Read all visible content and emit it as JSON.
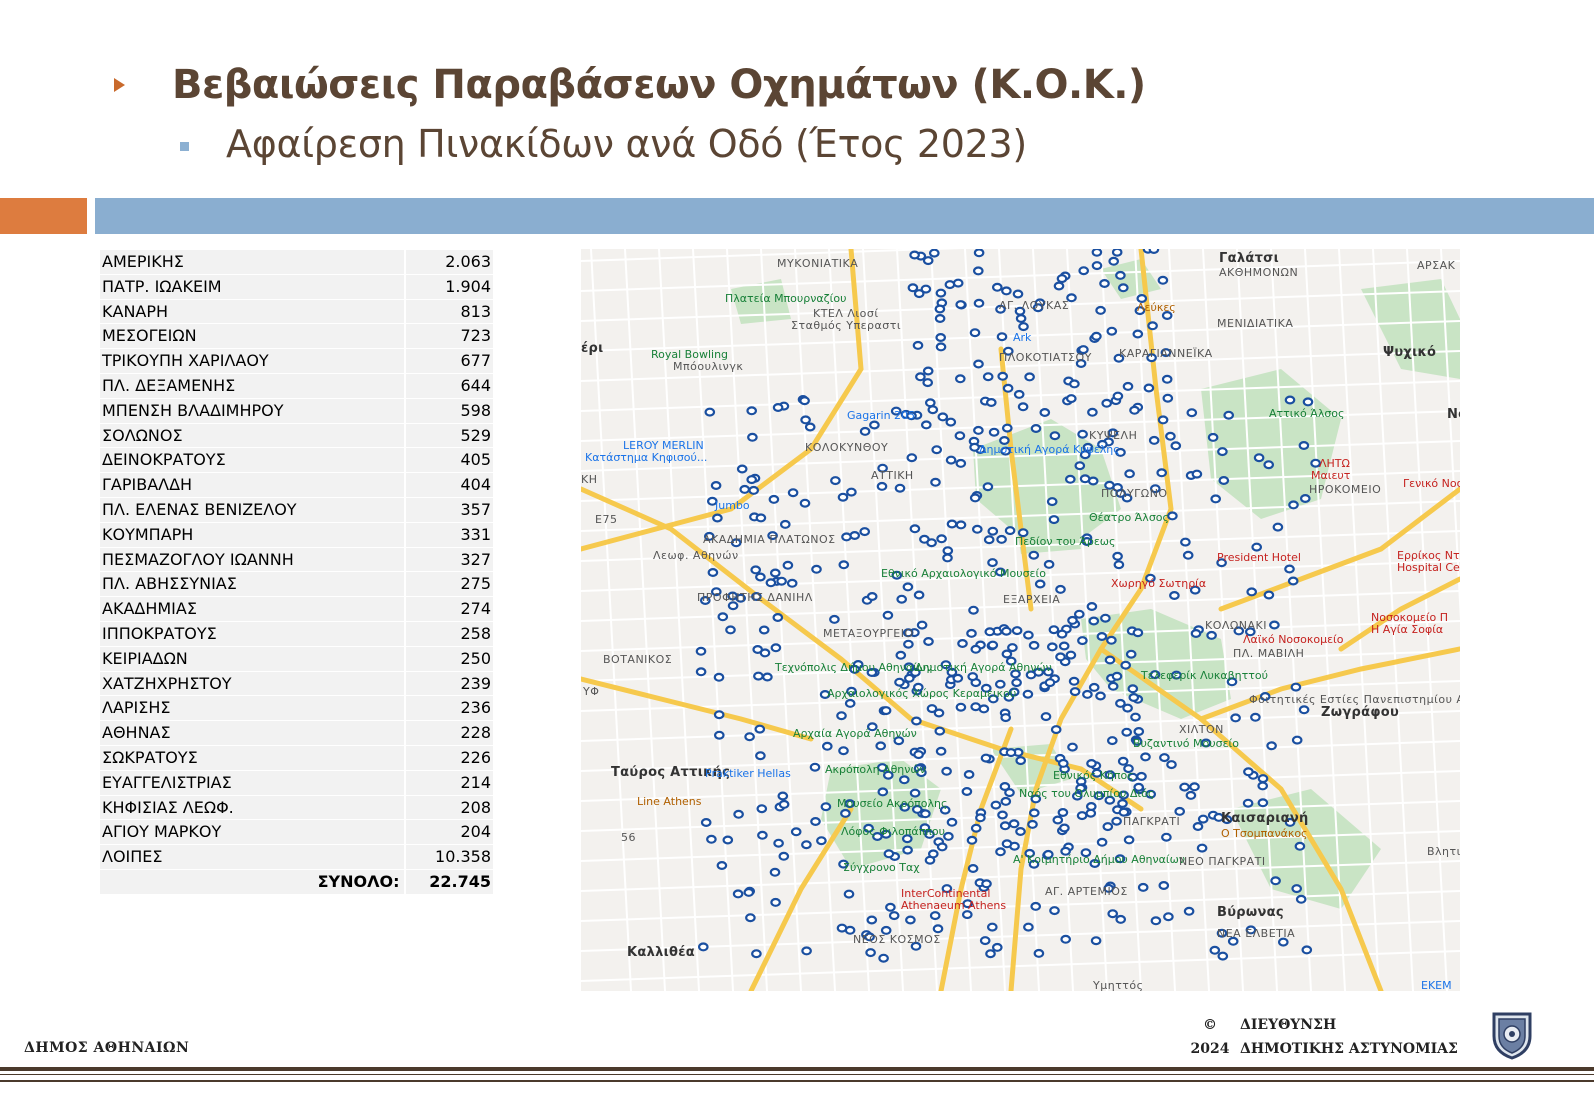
{
  "header": {
    "title": "Βεβαιώσεις Παραβάσεων Οχημάτων (Κ.Ο.Κ.)",
    "subtitle": "Αφαίρεση Πινακίδων ανά Οδό (Έτος 2023)",
    "accent_color": "#dd7c3f",
    "band_color": "#8aaed0",
    "text_color": "#5b4534"
  },
  "table": {
    "rows": [
      {
        "street": "ΑΜΕΡΙΚΗΣ",
        "count": "2.063"
      },
      {
        "street": "ΠΑΤΡ. ΙΩΑΚΕΙΜ",
        "count": "1.904"
      },
      {
        "street": "ΚΑΝΑΡΗ",
        "count": "813"
      },
      {
        "street": "ΜΕΣΟΓΕΙΩΝ",
        "count": "723"
      },
      {
        "street": "ΤΡΙΚΟΥΠΗ ΧΑΡΙΛΑΟΥ",
        "count": "677"
      },
      {
        "street": "ΠΛ. ΔΕΞΑΜΕΝΗΣ",
        "count": "644"
      },
      {
        "street": "ΜΠΕΝΣΗ ΒΛΑΔΙΜΗΡΟΥ",
        "count": "598"
      },
      {
        "street": "ΣΟΛΩΝΟΣ",
        "count": "529"
      },
      {
        "street": "ΔΕΙΝΟΚΡΑΤΟΥΣ",
        "count": "405"
      },
      {
        "street": "ΓΑΡΙΒΑΛΔΗ",
        "count": "404"
      },
      {
        "street": "ΠΛ. ΕΛΕΝΑΣ ΒΕΝΙΖΕΛΟΥ",
        "count": "357"
      },
      {
        "street": "ΚΟΥΜΠΑΡΗ",
        "count": "331"
      },
      {
        "street": "ΠΕΣΜΑΖΟΓΛΟΥ ΙΩΑΝΝΗ",
        "count": "327"
      },
      {
        "street": "ΠΛ. ΑΒΗΣΣΥΝΙΑΣ",
        "count": "275"
      },
      {
        "street": "ΑΚΑΔΗΜΙΑΣ",
        "count": "274"
      },
      {
        "street": "ΙΠΠΟΚΡΑΤΟΥΣ",
        "count": "258"
      },
      {
        "street": "ΚΕΙΡΙΑΔΩΝ",
        "count": "250"
      },
      {
        "street": "ΧΑΤΖΗΧΡΗΣΤΟΥ",
        "count": "239"
      },
      {
        "street": "ΛΑΡΙΣΗΣ",
        "count": "236"
      },
      {
        "street": "ΑΘΗΝΑΣ",
        "count": "228"
      },
      {
        "street": "ΣΩΚΡΑΤΟΥΣ",
        "count": "226"
      },
      {
        "street": "ΕΥΑΓΓΕΛΙΣΤΡΙΑΣ",
        "count": "214"
      },
      {
        "street": "ΚΗΦΙΣΙΑΣ ΛΕΩΦ.",
        "count": "208"
      },
      {
        "street": "ΑΓΙΟΥ ΜΑΡΚΟΥ",
        "count": "204"
      },
      {
        "street": "ΛΟΙΠΕΣ",
        "count": "10.358"
      }
    ],
    "total_label": "ΣΥΝΟΛΟ:",
    "total_value": "22.745"
  },
  "map": {
    "marker_color": "#1a4fa0",
    "labels": {
      "mykoniatika": "ΜΥΚΟΝΙΑΤΙΚΑ",
      "galatsi": "Γαλάτσι",
      "akthmonon": "ΑΚΘΗΜΟΝΩΝ",
      "arsak": "ΑΡΣΑΚ",
      "plateia_mpourn": "Πλατεία Μπουρναζίου",
      "ktel": "ΚΤΕΛ Λιοσί",
      "stathmos": "Σταθμός Υπεραστι",
      "ag_loukas": "ΑΓ. ΛΟΥΚΑΣ",
      "leykes": "Λεύκες",
      "menidiatika": "ΜΕΝΙΔΙΑΤΙΚΑ",
      "royal_bowling": "Royal Bowling",
      "mpoulingk": "Μπόουλινγκ",
      "peri": "έρι",
      "ark": "Ark",
      "plokotiatsou": "ΠΛΟΚΟΤΙΑΤΣΟΥ",
      "karagiannekia": "ΚΑΡΑΓΙΑΝΝΕΪΚΑ",
      "psychiko": "Ψυχικό",
      "gagarin": "Gagarin 205",
      "attiko_alsos": "Αττικό Άλσος",
      "ne": "Ne",
      "leroy": "LEROY MERLIN",
      "leroy2": "Κατάστημα Κηφισού...",
      "kolokynthou": "ΚΟΛΟΚΥΝΘΟΥ",
      "kypseli": "ΚΥΨΕΛΗ",
      "agora": "Δημοτική Αγορά Κυψέλης",
      "kh": "ΚΗ",
      "attiki": "ΑΤΤΙΚΗ",
      "polygono": "ΠΟΛΥΓΩΝΟ",
      "lhtw": "ΛΗΤΩ",
      "maieut": "Μαιευτ",
      "hprokomeio": "ΗΡΟΚΟΜΕΙΟ",
      "geniko": "Γενικό Νοσ",
      "jumbo": "Jumbo",
      "theatro": "Θέατρο Άλσος",
      "pedion": "Πεδίον του Άρεως",
      "akadimia": "ΑΚΑΔΗΜΙΑ ΠΛΑΤΩΝΟΣ",
      "leof_athinon": "Λεωφ. Αθηνών",
      "ethniko": "Εθνικό Αρχαιολογικό Μουσείο",
      "president": "President Hotel",
      "errikos": "Ερρίκος Ντ",
      "hospital": "Hospital Ce",
      "profitis": "ΠΡΟΦΗΤΗΣ ΔΑΝΙΗΛ",
      "exarcheia": "ΕΞΑΡΧΕΙΑ",
      "xorhgos": "Χωρηγό Σωτηρία",
      "nosokomeio": "Νοσοκομείο Π",
      "agia_sofia": "Η Αγία Σοφία",
      "metaxourgeio": "ΜΕΤΑΞΟΥΡΓΕΙΟ",
      "kolonaki": "ΚΟΛΩΝΑΚΙ",
      "laiko": "Λαϊκό Νοσοκομείο",
      "botaniko": "ΒΟΤΑΝΙΚΟΣ",
      "texnopolis": "Τεχνόπολις Δήμου Αθηναίων",
      "dimotiki_agora": "Δημοτική Αγορά Αθηνών",
      "teleferik": "Τελεφερίκ Λυκαβηττού",
      "mavili": "ΠΛ. ΜΑΒΙΛΗ",
      "foitites": "Φοιτητικές Εστίες Πανεπιστημίου Αθηνών",
      "zografou": "Ζωγράφου",
      "archaia_agora": "Αρχαία Αγορά Αθηνών",
      "kerameikos": "Αρχαιολογικός Χώρος Κεραμεικού",
      "ethnikos_kipos": "Εθνικός Κήπος",
      "vyzantino": "Βυζαντινό Μουσείο",
      "xilton": "ΧΙΛΤΟΝ",
      "tavros": "Ταύρος Αττικής",
      "praktiker": "Praktiker Hellas",
      "akropoli": "Ακρόπολη Αθηνών",
      "naos": "Ναός του Ολυμπίου Διός",
      "line_athens": "Line Athens",
      "mouseio_akro": "Μουσείο Ακρόπολης",
      "pagkrati": "ΠΑΓΚΡΑΤΙ",
      "kaisariani": "Καισαριανή",
      "tsompanakos": "Ο Τσομπανάκος",
      "lofos": "Λόφος Φιλοπάππου",
      "koimitirio": "Α' Κοιμητήριο Δήμου Αθηναίων",
      "neo_pagkrati": "ΝΕΟ ΠΑΓΚΡΑΤΙ",
      "vlhtiw": "Βλητικ Σταθμ",
      "syngrou": "Σύγχρονο Ταχ",
      "intercont": "InterContinental",
      "intercont2": "Athenaeum Athens",
      "ag_artemios": "ΑΓ. ΑΡΤΕΜΙΟΣ",
      "vyronas": "Βύρωνας",
      "nea_elvetia": "ΝΕΑ ΕΛΒΕΤΙΑ",
      "kallithea": "Καλλιθέα",
      "neos_kosmos": "ΝΕΟΣ ΚΟΣΜΟΣ",
      "ymittos": "Υμηττός",
      "ekem": "ΕΚΕΜ",
      "e75": "E75",
      "yf": "ΥΦ",
      "m56": "56"
    }
  },
  "footer": {
    "left": "ΔΗΜΟΣ ΑΘΗΝΑΙΩΝ",
    "copyright": "©",
    "year": "2024",
    "dept_line1": "ΔΙΕΥΘΥΝΣΗ",
    "dept_line2": "ΔΗΜΟΤΙΚΗΣ ΑΣΤΥΝΟΜΙΑΣ"
  }
}
